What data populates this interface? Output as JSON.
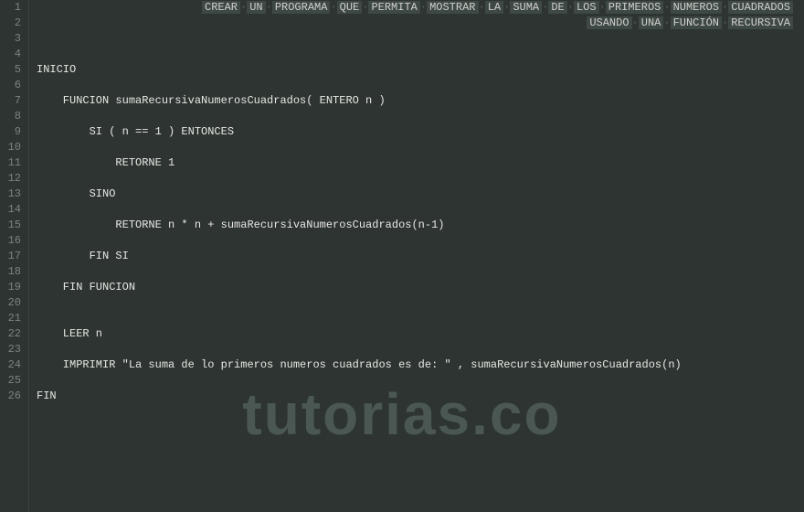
{
  "header": {
    "line1_words": [
      "CREAR",
      "UN",
      "PROGRAMA",
      "QUE",
      "PERMITA",
      "MOSTRAR",
      "LA",
      "SUMA",
      "DE",
      "LOS",
      "PRIMEROS",
      "NUMEROS",
      "CUADRADOS"
    ],
    "line2_words": [
      "USANDO",
      "UNA",
      "FUNCIÓN",
      "RECURSIVA"
    ]
  },
  "lines": [
    {
      "num": 1,
      "type": "header1"
    },
    {
      "num": 2,
      "type": "header2"
    },
    {
      "num": 3,
      "type": "blank"
    },
    {
      "num": 4,
      "type": "blank"
    },
    {
      "num": 5,
      "type": "code",
      "indent": 0,
      "text": "INICIO"
    },
    {
      "num": 6,
      "type": "blank"
    },
    {
      "num": 7,
      "type": "code",
      "indent": 1,
      "text": "FUNCION sumaRecursivaNumerosCuadrados( ENTERO n )"
    },
    {
      "num": 8,
      "type": "blank"
    },
    {
      "num": 9,
      "type": "code",
      "indent": 2,
      "text": "SI ( n == 1 ) ENTONCES"
    },
    {
      "num": 10,
      "type": "blank"
    },
    {
      "num": 11,
      "type": "code",
      "indent": 3,
      "text": "RETORNE 1"
    },
    {
      "num": 12,
      "type": "blank"
    },
    {
      "num": 13,
      "type": "code",
      "indent": 2,
      "text": "SINO"
    },
    {
      "num": 14,
      "type": "blank"
    },
    {
      "num": 15,
      "type": "code",
      "indent": 3,
      "text": "RETORNE n * n + sumaRecursivaNumerosCuadrados(n-1)"
    },
    {
      "num": 16,
      "type": "blank"
    },
    {
      "num": 17,
      "type": "code",
      "indent": 2,
      "text": "FIN SI"
    },
    {
      "num": 18,
      "type": "blank"
    },
    {
      "num": 19,
      "type": "code",
      "indent": 1,
      "text": "FIN FUNCION"
    },
    {
      "num": 20,
      "type": "blank"
    },
    {
      "num": 21,
      "type": "blank"
    },
    {
      "num": 22,
      "type": "code",
      "indent": 1,
      "text": "LEER n"
    },
    {
      "num": 23,
      "type": "blank"
    },
    {
      "num": 24,
      "type": "code",
      "indent": 1,
      "text": "IMPRIMIR \"La suma de lo primeros numeros cuadrados es de: \" , sumaRecursivaNumerosCuadrados(n)"
    },
    {
      "num": 25,
      "type": "blank"
    },
    {
      "num": 26,
      "type": "code",
      "indent": 0,
      "text": "FIN"
    }
  ],
  "watermark": "tutorias.co",
  "indent_unit": "    "
}
